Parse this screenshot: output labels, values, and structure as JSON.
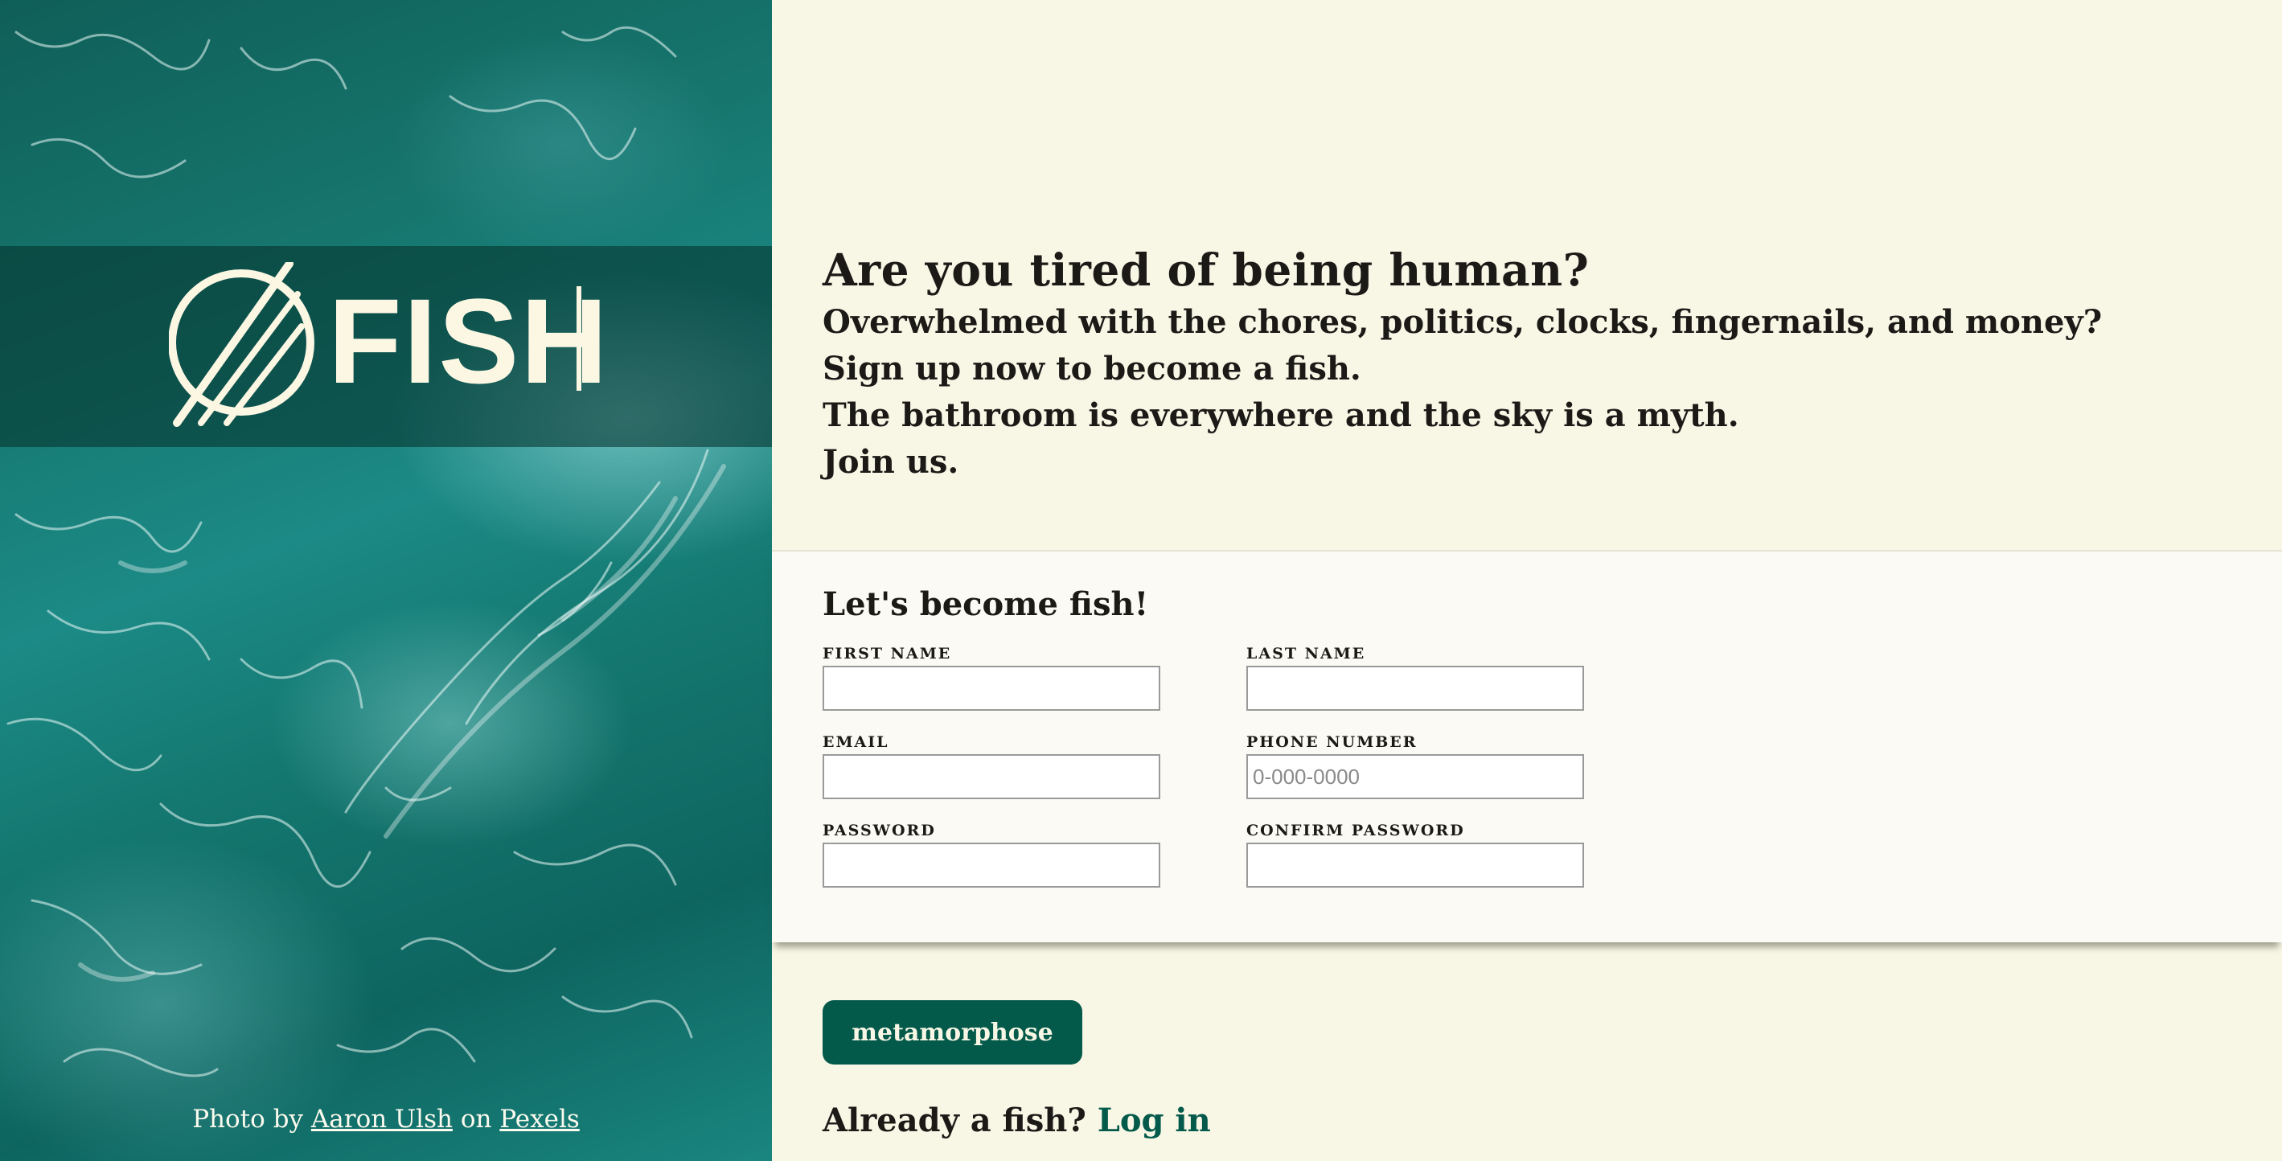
{
  "brand": {
    "name": "FISH",
    "logo_icon": "slashed-circle-icon"
  },
  "photo_credit": {
    "prefix": "Photo by",
    "author": "Aaron Ulsh",
    "middle": "on",
    "source": "Pexels"
  },
  "hero": {
    "headline": "Are you tired of being human?",
    "lines": [
      "Overwhelmed with the chores, politics, clocks, fingernails, and money?",
      "Sign up now to become a fish.",
      "The bathroom is everywhere and the sky is a myth.",
      "Join us."
    ]
  },
  "form": {
    "title": "Let's become fish!",
    "fields": {
      "first_name": {
        "label": "FIRST NAME",
        "value": "",
        "placeholder": ""
      },
      "last_name": {
        "label": "LAST NAME",
        "value": "",
        "placeholder": ""
      },
      "email": {
        "label": "EMAIL",
        "value": "",
        "placeholder": ""
      },
      "phone": {
        "label": "PHONE NUMBER",
        "value": "",
        "placeholder": "0-000-0000"
      },
      "password": {
        "label": "PASSWORD",
        "value": "",
        "placeholder": ""
      },
      "confirm_password": {
        "label": "CONFIRM PASSWORD",
        "value": "",
        "placeholder": ""
      }
    },
    "submit_label": "metamorphose"
  },
  "login": {
    "prompt": "Already a fish?",
    "link_label": "Log in"
  },
  "colors": {
    "background": "#f8f7e6",
    "card": "#fbfaf4",
    "accent": "#03594a",
    "text": "#1c1a17"
  }
}
